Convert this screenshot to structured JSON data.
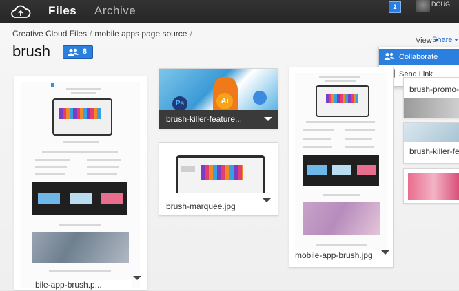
{
  "topbar": {
    "nav": [
      {
        "label": "Files",
        "active": true
      },
      {
        "label": "Archive",
        "active": false
      }
    ],
    "notification_count": "2",
    "user_name": "DOUG"
  },
  "breadcrumb": [
    "Creative Cloud Files",
    "mobile apps page source"
  ],
  "breadcrumb_separator": "/",
  "folder": {
    "title": "brush",
    "collaborator_count": "8"
  },
  "toolbar": {
    "view_label": "View",
    "share_label": "Share"
  },
  "share_menu": {
    "items": [
      {
        "label": "Collaborate",
        "icon": "collaborators-icon",
        "highlighted": true
      },
      {
        "label": "Send Link",
        "icon": "envelope-icon",
        "highlighted": false
      }
    ]
  },
  "files": [
    {
      "name": "bile-app-brush.p..."
    },
    {
      "name": "brush-killer-feature..."
    },
    {
      "name": "brush-marquee.jpg"
    },
    {
      "name": "mobile-app-brush.jpg"
    },
    {
      "name": "brush-promo-ba"
    },
    {
      "name": "brush-killer-featu"
    }
  ],
  "preview_labels": {
    "ps": "Ps",
    "ai": "Ai"
  },
  "colors": {
    "accent": "#2b7fde",
    "topbar": "#2b2b2b"
  }
}
